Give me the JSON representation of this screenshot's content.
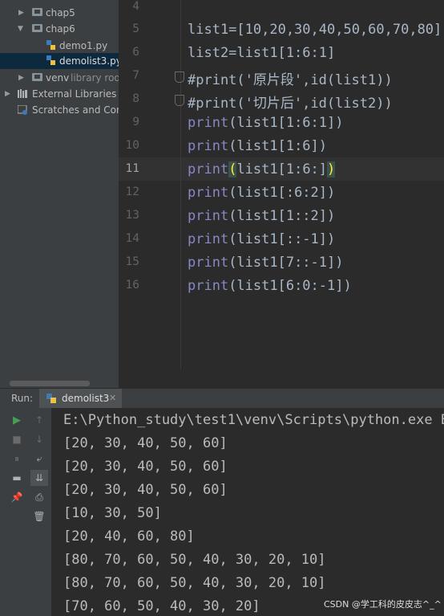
{
  "project_tree": {
    "items": [
      {
        "label": "chap5",
        "kind": "folder",
        "expanded": false
      },
      {
        "label": "chap6",
        "kind": "folder",
        "expanded": true
      },
      {
        "label": "demo1.py",
        "kind": "python-file"
      },
      {
        "label": "demolist3.py",
        "kind": "python-file",
        "selected": true
      },
      {
        "label": "venv",
        "suffix": "library root",
        "kind": "folder",
        "expanded": false
      },
      {
        "label": "External Libraries",
        "kind": "libraries"
      },
      {
        "label": "Scratches and Consoles",
        "kind": "scratches"
      }
    ]
  },
  "editor": {
    "current_line": "11",
    "line_numbers": [
      "4",
      "5",
      "6",
      "7",
      "8",
      "9",
      "10",
      "11",
      "12",
      "13",
      "14",
      "15",
      "16"
    ],
    "lines": [
      "",
      "list1=[10,20,30,40,50,60,70,80]",
      "list2=list1[1:6:1]",
      "#print('原片段',id(list1))",
      "#print('切片后',id(list2))",
      "print(list1[1:6:1])",
      "print(list1[1:6])",
      "print(list1[1:6:])",
      "print(list1[:6:2])",
      "print(list1[1::2])",
      "print(list1[::-1])",
      "print(list1[7::-1])",
      "print(list1[6:0:-1])"
    ]
  },
  "run_panel": {
    "title": "Run:",
    "tab_label": "demolist3",
    "output": [
      "E:\\Python_study\\test1\\venv\\Scripts\\python.exe E:/",
      "[20, 30, 40, 50, 60]",
      "[20, 30, 40, 50, 60]",
      "[20, 30, 40, 50, 60]",
      "[10, 30, 50]",
      "[20, 40, 60, 80]",
      "[80, 70, 60, 50, 40, 30, 20, 10]",
      "[80, 70, 60, 50, 40, 30, 20, 10]",
      "[70, 60, 50, 40, 30, 20]"
    ]
  },
  "watermark": "CSDN @学工科的皮皮志^_^",
  "colors": {
    "editor_bg": "#2b2b2b",
    "panel_bg": "#3c3f41",
    "keyword_print": "#8888c6",
    "comment": "#808080",
    "bracket_highlight": "#ffef28",
    "run_green": "#499c54"
  }
}
